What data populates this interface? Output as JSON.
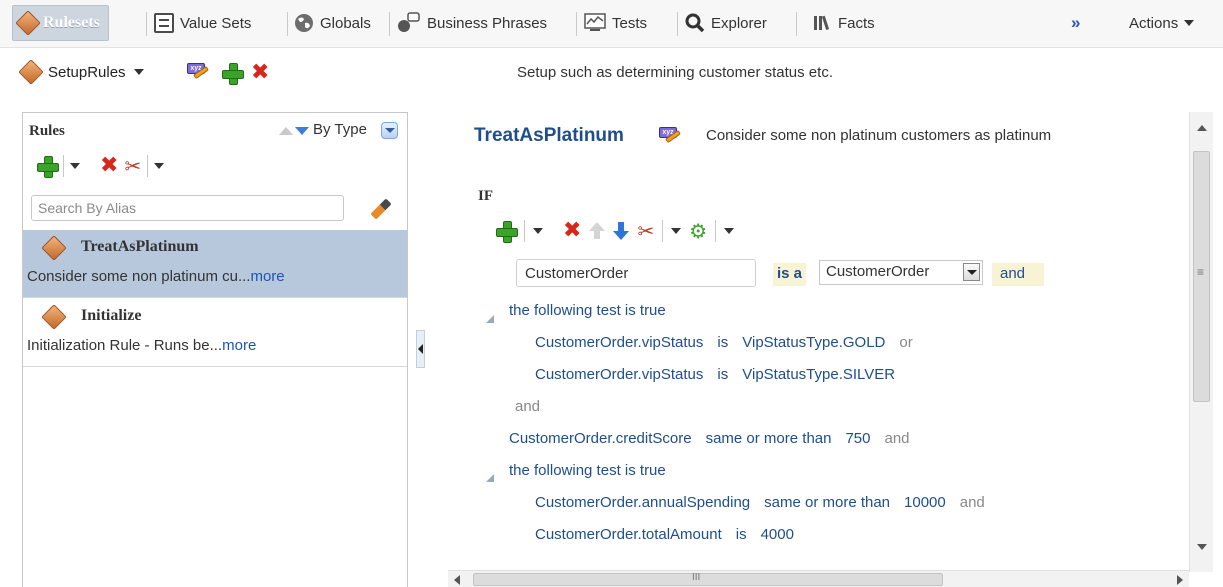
{
  "tabs": [
    {
      "label": "Rulesets",
      "icon": "ruleset-gem-icon",
      "active": true
    },
    {
      "label": "Value Sets",
      "icon": "value-sets-icon"
    },
    {
      "label": "Globals",
      "icon": "globe-icon"
    },
    {
      "label": "Business Phrases",
      "icon": "business-phrases-icon"
    },
    {
      "label": "Tests",
      "icon": "tests-icon"
    },
    {
      "label": "Explorer",
      "icon": "search-icon"
    },
    {
      "label": "Facts",
      "icon": "facts-icon"
    }
  ],
  "overflow_glyph": "»",
  "actions_label": "Actions",
  "ruleset": {
    "name": "SetupRules",
    "description": "Setup such as determining customer status etc."
  },
  "rules_panel": {
    "title": "Rules",
    "sort_label": "By Type",
    "search_placeholder": "Search By Alias",
    "items": [
      {
        "name": "TreatAsPlatinum",
        "desc": "Consider some non platinum cu...",
        "more": "more",
        "selected": true
      },
      {
        "name": "Initialize",
        "desc": "Initialization Rule - Runs be...",
        "more": "more",
        "selected": false
      }
    ]
  },
  "rule": {
    "name": "TreatAsPlatinum",
    "description": "Consider some non platinum customers as platinum",
    "if_label": "IF",
    "fact_alias": "CustomerOrder",
    "is_a": "is a",
    "fact_type": "CustomerOrder",
    "and_label": "and",
    "conditions": {
      "group1_label": "the following test is true",
      "c1": {
        "left": "CustomerOrder.vipStatus",
        "op": "is",
        "right": "VipStatusType.GOLD",
        "logic": "or"
      },
      "c2": {
        "left": "CustomerOrder.vipStatus",
        "op": "is",
        "right": "VipStatusType.SILVER"
      },
      "group1_logic": "and",
      "c3": {
        "left": "CustomerOrder.creditScore",
        "op": "same or more than",
        "right": "750",
        "logic": "and"
      },
      "group2_label": "the following test is true",
      "c4": {
        "left": "CustomerOrder.annualSpending",
        "op": "same or more than",
        "right": "10000",
        "logic": "and"
      },
      "c5": {
        "left": "CustomerOrder.totalAmount",
        "op": "is",
        "right": "4000"
      }
    }
  },
  "colors": {
    "accent": "#1e4e8c",
    "selection": "#b7c8dd",
    "highlight": "#f9f3d6"
  }
}
